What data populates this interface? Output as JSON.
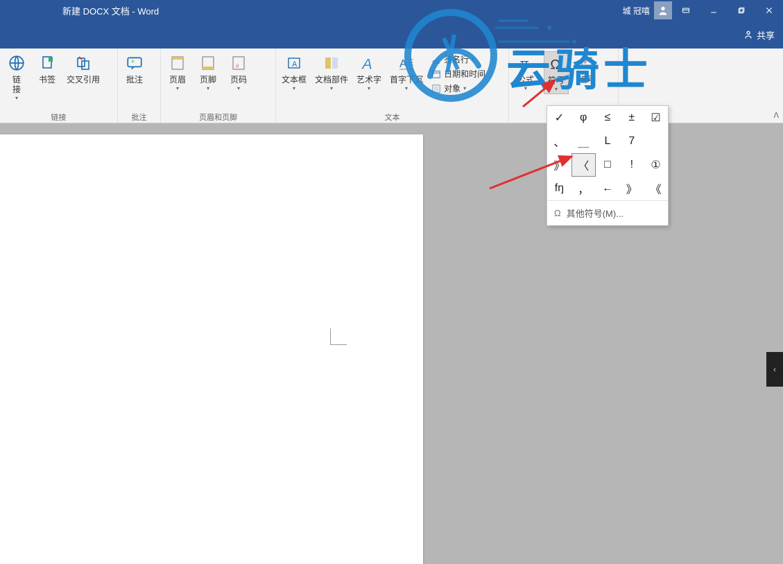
{
  "title": "新建 DOCX 文档  -  Word",
  "user": "城 冠嘻",
  "share_label": "共享",
  "ribbon": {
    "groups": {
      "links": {
        "label": "链接",
        "link": "链\n接",
        "bookmark": "书签",
        "crossref": "交叉引用"
      },
      "comments": {
        "label": "批注",
        "comment": "批注"
      },
      "headerfooter": {
        "label": "页眉和页脚",
        "header": "页眉",
        "footer": "页脚",
        "pagenum": "页码"
      },
      "text": {
        "label": "文本",
        "textbox": "文本框",
        "parts": "文档部件",
        "wordart": "艺术字",
        "dropcap": "首字下沉",
        "sigline": "签名行",
        "datetime": "日期和时间",
        "object": "对象"
      },
      "symbols": {
        "label": "",
        "equation": "公式",
        "symbol": "符号",
        "number": "编号"
      }
    }
  },
  "symbols": {
    "grid": [
      "✓",
      "φ",
      "≤",
      "±",
      "☑",
      "、",
      "＿",
      "L",
      "7",
      "",
      "》",
      "〈",
      "□",
      "!",
      "①",
      "fŋ",
      "，",
      "←",
      "》",
      "《"
    ],
    "more": "其他符号(M)...",
    "omega": "Ω"
  },
  "watermark_text": "云骑士"
}
